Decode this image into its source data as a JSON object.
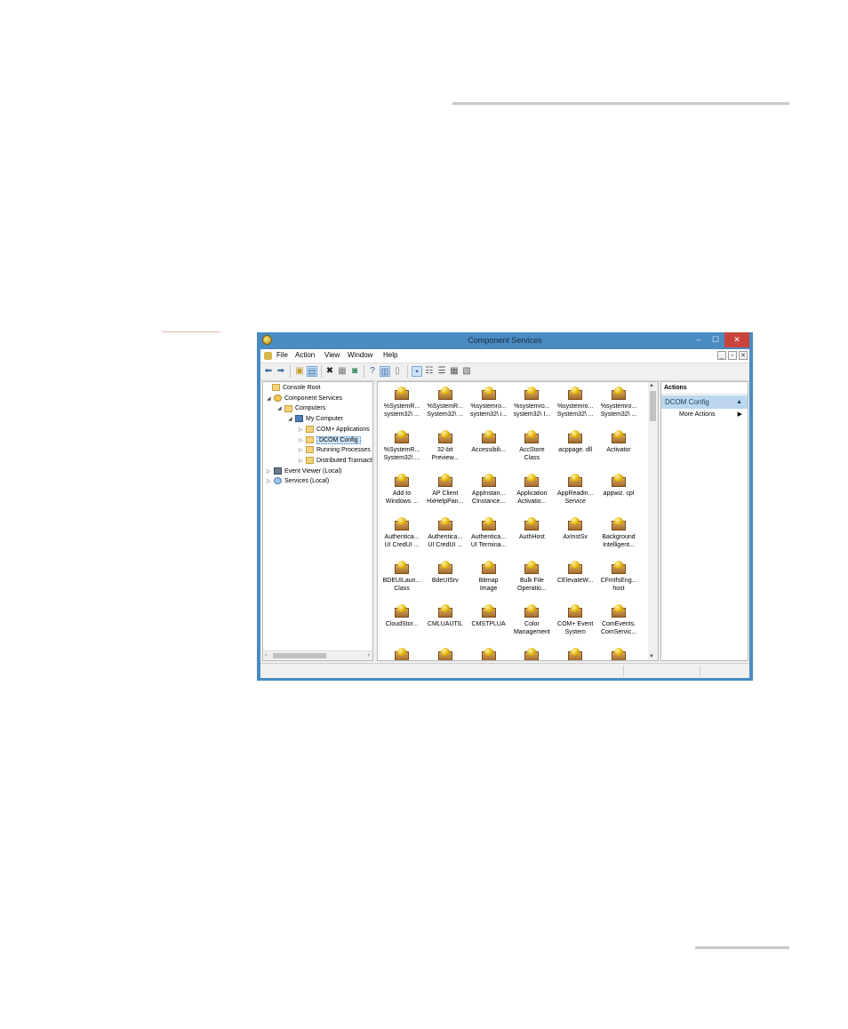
{
  "window": {
    "title": "Component Services",
    "controls": {
      "minimize": "–",
      "maximize": "☐",
      "close": "✕"
    }
  },
  "menu": [
    "File",
    "Action",
    "View",
    "Window",
    "Help"
  ],
  "mdi_controls": [
    "_",
    "▫",
    "✕"
  ],
  "toolbar": [
    "back-arrow-icon",
    "forward-arrow-icon",
    "up-folder-icon",
    "show-tree-icon",
    "delete-icon",
    "properties-icon",
    "refresh-icon",
    "help-icon",
    "show-action-pane-icon",
    "export-icon",
    "large-icons-icon",
    "small-icons-icon",
    "list-icon",
    "details-icon",
    "detail-grid-icon"
  ],
  "tree": [
    {
      "label": "Console Root",
      "level": 0,
      "exp": "",
      "icon": "fold"
    },
    {
      "label": "Component Services",
      "level": 1,
      "exp": "◢",
      "icon": "gear"
    },
    {
      "label": "Computers",
      "level": 2,
      "exp": "◢",
      "icon": "fold"
    },
    {
      "label": "My Computer",
      "level": 3,
      "exp": "◢",
      "icon": "comp"
    },
    {
      "label": "COM+ Applications",
      "level": 4,
      "exp": "▷",
      "icon": "fold"
    },
    {
      "label": "DCOM Config",
      "level": 4,
      "exp": "▷",
      "icon": "fold",
      "selected": true
    },
    {
      "label": "Running Processes",
      "level": 4,
      "exp": "▷",
      "icon": "fold"
    },
    {
      "label": "Distributed Transactio",
      "level": 4,
      "exp": "▷",
      "icon": "fold"
    },
    {
      "label": "Event Viewer (Local)",
      "level": 1,
      "exp": "▷",
      "icon": "ev"
    },
    {
      "label": "Services (Local)",
      "level": 1,
      "exp": "▷",
      "icon": "svc"
    }
  ],
  "items": [
    [
      "%SystemR...",
      "system32\\ ..."
    ],
    [
      "%SystemR...",
      "System32\\ ..."
    ],
    [
      "%systemro...",
      "system32\\ i..."
    ],
    [
      "%systemro...",
      "system32\\ I..."
    ],
    [
      "%systemro...",
      "System32\\ ..."
    ],
    [
      "%systemro...",
      "System32\\ ..."
    ],
    [
      "%SystemR...",
      "System32\\ ..."
    ],
    [
      "32-bit",
      "Preview..."
    ],
    [
      "Accessibili...",
      ""
    ],
    [
      "AccStore",
      "Class"
    ],
    [
      "acppage. dll",
      ""
    ],
    [
      "Activator",
      ""
    ],
    [
      "Add to",
      "Windows ..."
    ],
    [
      "AP Client",
      "HxHelpPan..."
    ],
    [
      "AppInstan...",
      "CInstance..."
    ],
    [
      "Application",
      "Activatio..."
    ],
    [
      "AppReadin...",
      "Service"
    ],
    [
      "appwiz. cpl",
      ""
    ],
    [
      "Authentica...",
      "UI CredUI ..."
    ],
    [
      "Authentica...",
      "UI CredUI ..."
    ],
    [
      "Authentica...",
      "UI Termina..."
    ],
    [
      "AuthHost",
      ""
    ],
    [
      "AxInstSv",
      ""
    ],
    [
      "Background",
      "Intelligent..."
    ],
    [
      "BDEUILaun...",
      "Class"
    ],
    [
      "BdeUISrv",
      ""
    ],
    [
      "Bitmap",
      "Image"
    ],
    [
      "Bulk File",
      "Operatio..."
    ],
    [
      "CElevateW...",
      ""
    ],
    [
      "CFmIfsEng...",
      "host"
    ],
    [
      "CloudStor...",
      ""
    ],
    [
      "CMLUAUTIL",
      ""
    ],
    [
      "CMSTPLUA",
      ""
    ],
    [
      "Color",
      "Management"
    ],
    [
      "COM+ Event",
      "System"
    ],
    [
      "ComEvents.",
      "ComServic..."
    ],
    [
      "",
      ""
    ],
    [
      "",
      ""
    ],
    [
      "",
      ""
    ],
    [
      "",
      ""
    ],
    [
      "",
      ""
    ],
    [
      "",
      ""
    ]
  ],
  "actions": {
    "header": "Actions",
    "section": "DCOM Config",
    "item": "More Actions"
  }
}
